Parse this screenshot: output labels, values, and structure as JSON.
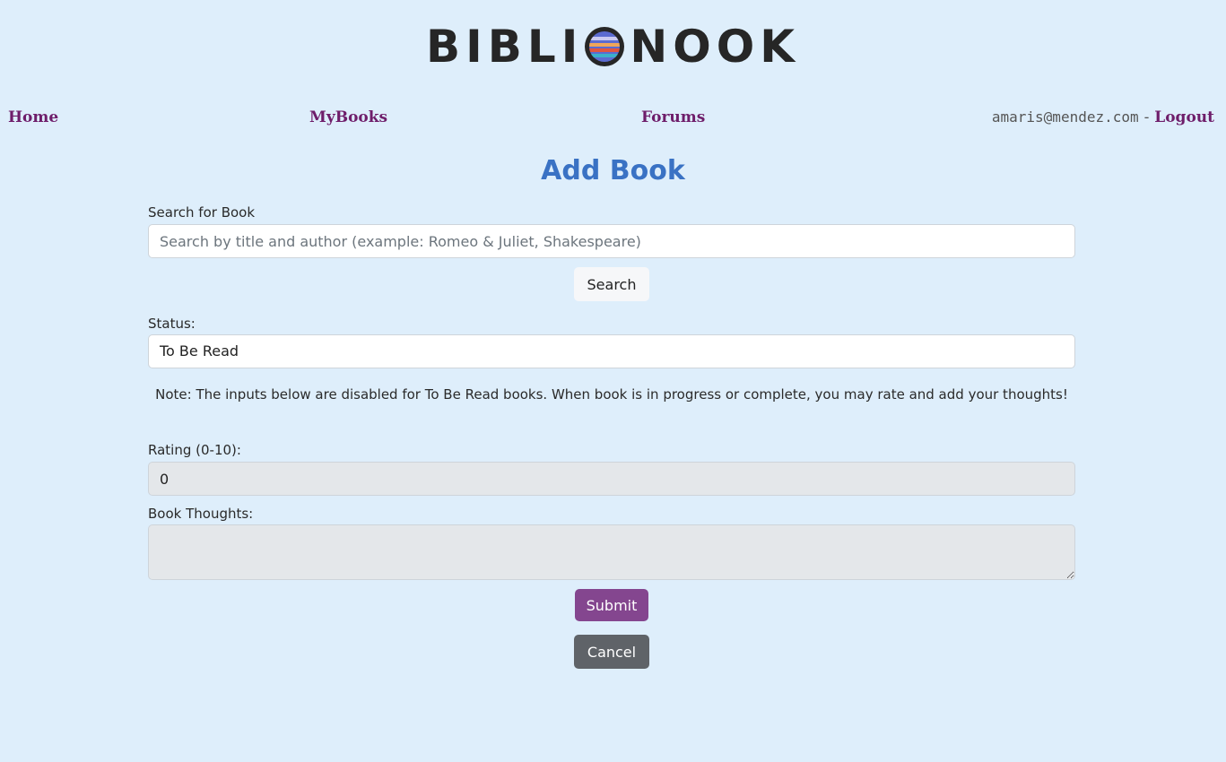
{
  "brand": {
    "logo_left": "BIBLI",
    "logo_right": "NOOK"
  },
  "nav": {
    "home": "Home",
    "mybooks": "MyBooks",
    "forums": "Forums",
    "user_email": "amaris@mendez.com",
    "separator": "-",
    "logout": "Logout"
  },
  "page": {
    "title": "Add Book"
  },
  "search": {
    "label": "Search for Book",
    "placeholder": "Search by title and author (example: Romeo & Juliet, Shakespeare)",
    "button": "Search"
  },
  "status": {
    "label": "Status:",
    "value": "To Be Read"
  },
  "note": "Note: The inputs below are disabled for To Be Read books. When book is in progress or complete, you may rate and add your thoughts!",
  "rating": {
    "label": "Rating (0-10):",
    "value": "0"
  },
  "thoughts": {
    "label": "Book Thoughts:",
    "value": ""
  },
  "actions": {
    "submit": "Submit",
    "cancel": "Cancel"
  },
  "colors": {
    "background": "#deeefb",
    "nav_link": "#6e1d6a",
    "title": "#3a72c4",
    "submit": "#84468f",
    "cancel": "#5f6368"
  }
}
